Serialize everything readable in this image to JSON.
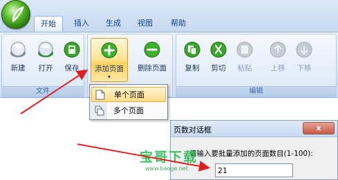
{
  "tabs": [
    {
      "label": "开始",
      "active": true
    },
    {
      "label": "插入",
      "active": false
    },
    {
      "label": "生成",
      "active": false
    },
    {
      "label": "视图",
      "active": false
    },
    {
      "label": "帮助",
      "active": false
    }
  ],
  "ribbon": {
    "file_group": {
      "label": "文件",
      "buttons": [
        {
          "label": "新建",
          "icon": "new-orb-icon"
        },
        {
          "label": "打开",
          "icon": "open-orb-icon"
        },
        {
          "label": "保存",
          "icon": "save-orb-icon"
        }
      ]
    },
    "page_group": {
      "add_page": {
        "label": "添加页面",
        "dropdown_arrow": "▾",
        "icon": "add-page-icon"
      },
      "delete_page": {
        "label": "删除页面",
        "icon": "delete-page-icon"
      }
    },
    "edit_group": {
      "label": "编辑",
      "buttons": [
        {
          "label": "复制",
          "icon": "copy-icon",
          "disabled": false
        },
        {
          "label": "剪切",
          "icon": "cut-icon",
          "disabled": false
        },
        {
          "label": "粘贴",
          "icon": "paste-icon",
          "disabled": true
        },
        {
          "label": "上移",
          "icon": "move-up-icon",
          "disabled": true
        },
        {
          "label": "下移",
          "icon": "move-down-icon",
          "disabled": true
        }
      ]
    }
  },
  "dropdown_menu": {
    "items": [
      {
        "label": "单个页面",
        "selected": true
      },
      {
        "label": "多个页面",
        "selected": false
      }
    ]
  },
  "dialog": {
    "title": "页数对话框",
    "close_label": "x",
    "prompt": "请输入要批量添加的页面数目(1-100):",
    "input_value": "21"
  },
  "watermark": {
    "text": "宝哥下载",
    "url": "www.baoge.net"
  },
  "colors": {
    "ribbon_highlight": "#ffd25f",
    "arrow": "#e02020",
    "orb_green": "#2e9a1c",
    "watermark_green": "#1fb94a"
  }
}
